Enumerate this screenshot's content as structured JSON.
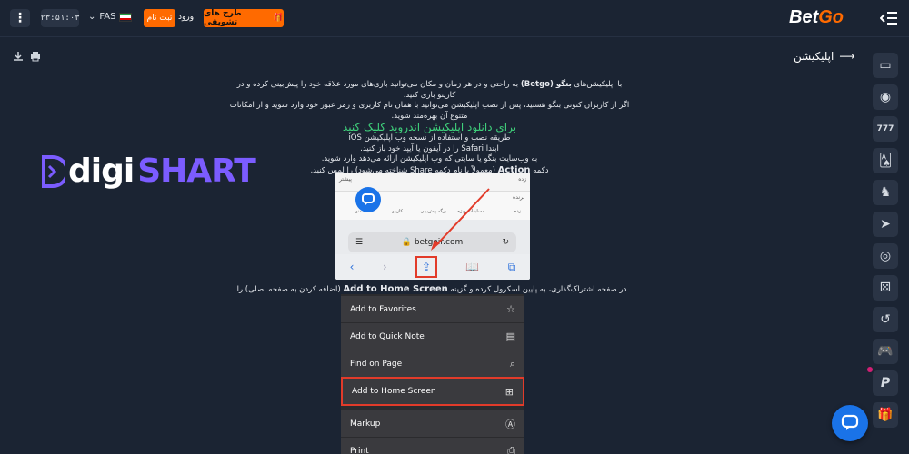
{
  "header": {
    "menu_icon": "kebab-vertical-icon",
    "clock": "۲۳:۵۱:۰۳",
    "language": "FAS",
    "register_label": "ثبت نام",
    "login_label": "ورود",
    "promo_label": "طرح های تشویقی",
    "logo_text_a": "Bet",
    "logo_text_b": "Go"
  },
  "toolbar": {
    "download_icon": "download-icon",
    "print_icon": "print-icon"
  },
  "page": {
    "title": "اپلیکیشن"
  },
  "article": {
    "p1a": "با اپلیکیشن‌های ",
    "p1_brand": "بتگو (Betgo)",
    "p1b": " به راحتی و در هر زمان و مکان می‌توانید بازی‌های مورد علاقه خود را پیش‌بینی کرده و در کازینو بازی کنید.",
    "p2": "اگر از کاربران کنونی بتگو هستید، پس از نصب اپلیکیشن می‌توانید با همان نام کاربری و رمز عبور خود وارد شوید و از امکانات متنوع آن بهره‌مند شوید.",
    "download_link": "برای دانلود اپلیکیشن اندروید کلیک کنید",
    "ios_heading": "طریقه نصب و استفاده از نسخه وب اپلیکیشن iOS",
    "step1": "ابتدا Safari را در آیفون یا آیپد خود باز کنید.",
    "step2": "به وب‌سایت بتگو یا سایتی که وب اپلیکیشن ارائه می‌دهد وارد شوید.",
    "step3a": "دکمه ",
    "step3_action": "Action",
    "step3b": " (معمولاً با نام دکمه Share شناخته می‌شود) را لمس کنید.",
    "step4a": "در صفحه اشتراک‌گذاری، به پایین اسکرول کرده و گزینه ",
    "step4_strong": "Add to Home Screen",
    "step4b": " (اضافه کردن به صفحه اصلی) را انتخاب کنید."
  },
  "screenshot1": {
    "top_left": "پیشتر",
    "top_right": "زده",
    "sub_right": "برنده",
    "tab_labels": [
      "زده",
      "مسابقات ویژه",
      "برگه پیش‌بینی",
      "کازینو",
      "منو"
    ],
    "url": "betgoir.com"
  },
  "share_menu": {
    "items": [
      {
        "label": "Add to Favorites",
        "icon": "star-icon"
      },
      {
        "label": "Add to Quick Note",
        "icon": "quick-note-icon"
      },
      {
        "label": "Find on Page",
        "icon": "find-icon"
      },
      {
        "label": "Add to Home Screen",
        "icon": "plus-square-icon"
      },
      {
        "label": "Markup",
        "icon": "markup-icon"
      },
      {
        "label": "Print",
        "icon": "print-icon"
      }
    ]
  },
  "watermark": {
    "part1": "digi",
    "part2": "SHART"
  },
  "sidebar": {
    "items": [
      "sports-icon",
      "live-icon",
      "slots-777-icon",
      "cards-icon",
      "horse-icon",
      "paper-plane-icon",
      "poker-chip-icon",
      "dice-icon",
      "aviator-icon",
      "gamepad-icon",
      "p-icon",
      "gift-icon"
    ]
  },
  "colors": {
    "background": "#1b2433",
    "accent": "#ff6a00",
    "link_green": "#3fd07b",
    "chat_blue": "#1a73e8"
  }
}
